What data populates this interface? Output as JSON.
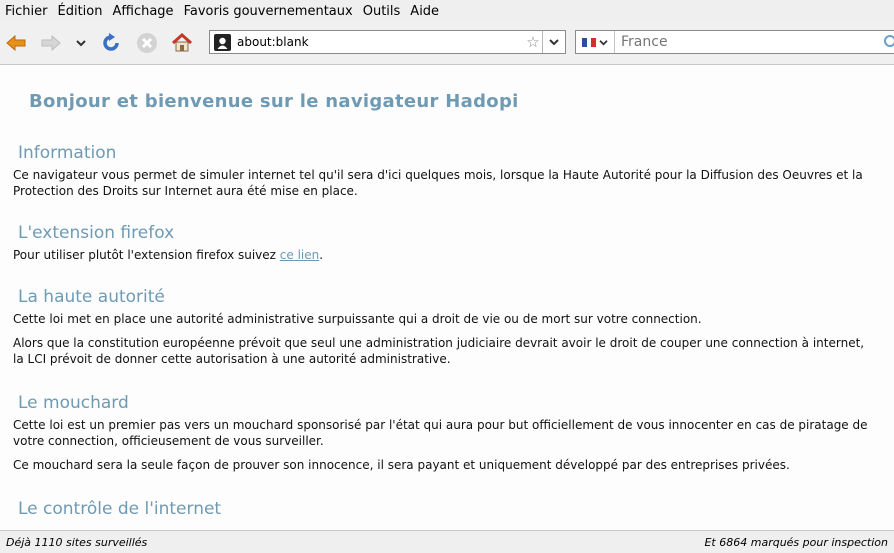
{
  "menu": [
    "Fichier",
    "Édition",
    "Affichage",
    "Favoris gouvernementaux",
    "Outils",
    "Aide"
  ],
  "urlbar": {
    "url": "about:blank"
  },
  "search": {
    "placeholder": "France"
  },
  "colors": {
    "heading": "#6f9ab3",
    "back_arrow": "#e8901c",
    "reload": "#3a6fc4"
  },
  "page": {
    "title": "Bonjour et bienvenue sur le navigateur Hadopi",
    "sections": [
      {
        "heading": "Information",
        "paragraphs": [
          "Ce navigateur vous permet de simuler internet tel qu'il sera d'ici quelques mois, lorsque la Haute Autorité pour la Diffusion des Oeuvres et la Protection des Droits sur Internet aura été mise en place."
        ]
      },
      {
        "heading": "L'extension firefox",
        "text_before": "Pour utiliser plutôt l'extension firefox suivez ",
        "link": "ce lien",
        "text_after": "."
      },
      {
        "heading": "La haute autorité",
        "paragraphs": [
          "Cette loi met en place une autorité administrative surpuissante qui a droit de vie ou de mort sur votre connection.",
          "Alors que la constitution européenne prévoit que seul une administration judiciaire devrait avoir le droit de couper une connection à internet, la LCI prévoit de donner cette autorisation à une autorité administrative."
        ]
      },
      {
        "heading": "Le mouchard",
        "paragraphs": [
          "Cette loi est un premier pas vers un mouchard sponsorisé par l'état qui aura pour but officiellement de vous innocenter en cas de piratage de votre connection, officieusement de vous surveiller.",
          "Ce mouchard sera la seule façon de prouver son innocence, il sera payant et uniquement développé par des entreprises privées."
        ]
      },
      {
        "heading": "Le contrôle de l'internet"
      }
    ]
  },
  "status": {
    "left": "Déjà 1110 sites surveillés",
    "right": "Et 6864 marqués pour inspection"
  }
}
